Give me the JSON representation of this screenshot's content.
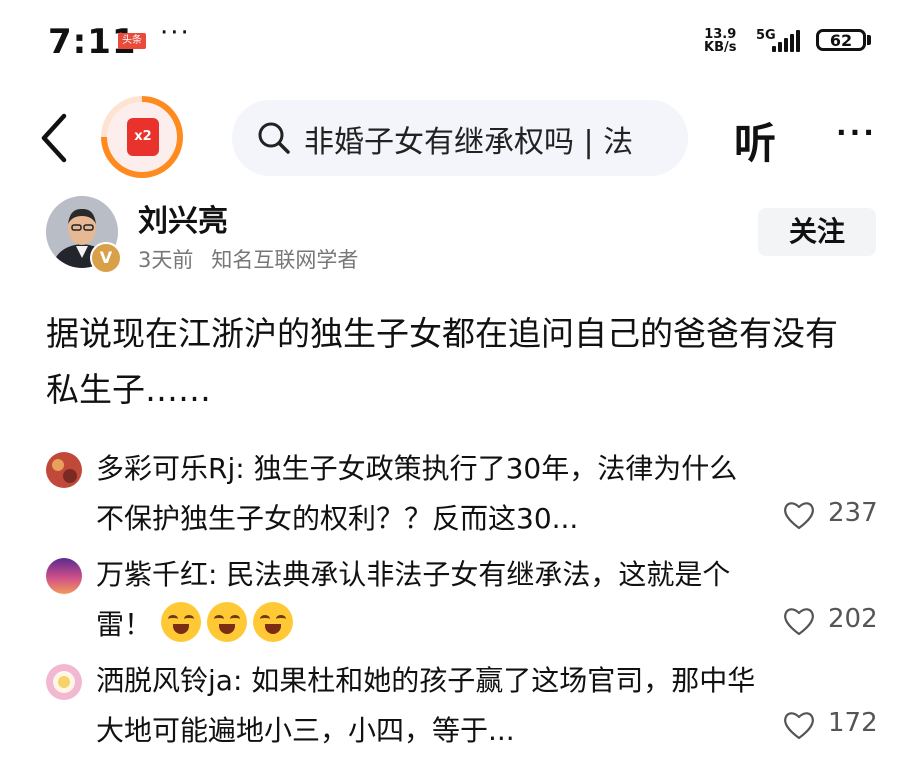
{
  "status_bar": {
    "time": "7:11",
    "app_badge": "头条",
    "dots": "···",
    "net_speed_value": "13.9",
    "net_speed_unit": "KB/s",
    "network_type": "5G",
    "battery": "62"
  },
  "nav": {
    "reward_label": "x2",
    "search_text": "非婚子女有继承权吗 | 法",
    "listen_label": "听",
    "more_label": "···"
  },
  "author": {
    "name": "刘兴亮",
    "time": "3天前",
    "title": "知名互联网学者",
    "verified_label": "V",
    "follow_label": "关注"
  },
  "post": {
    "text": "据说现在江浙沪的独生子女都在追问自己的爸爸有没有私生子……"
  },
  "comments": [
    {
      "user": "多彩可乐Rj",
      "text": "独生子女政策执行了30年，法律为什么不保护独生子女的权利？？反而这30...",
      "likes": "237",
      "avatar_color": "#c0493a"
    },
    {
      "user": "万紫千红",
      "text": "民法典承认非法子女有继承法，这就是个雷！",
      "emoji_count": 3,
      "likes": "202",
      "avatar_color": "#7b3fa0"
    },
    {
      "user": "洒脱风铃ja",
      "text": "如果杜和她的孩子赢了这场官司，那中华大地可能遍地小三，小四，等于...",
      "likes": "172",
      "avatar_color": "#f2b8d2"
    }
  ],
  "icons": {
    "back": "chevron-left-icon",
    "search": "search-icon",
    "like": "heart-outline-icon",
    "reward": "red-envelope-icon"
  }
}
